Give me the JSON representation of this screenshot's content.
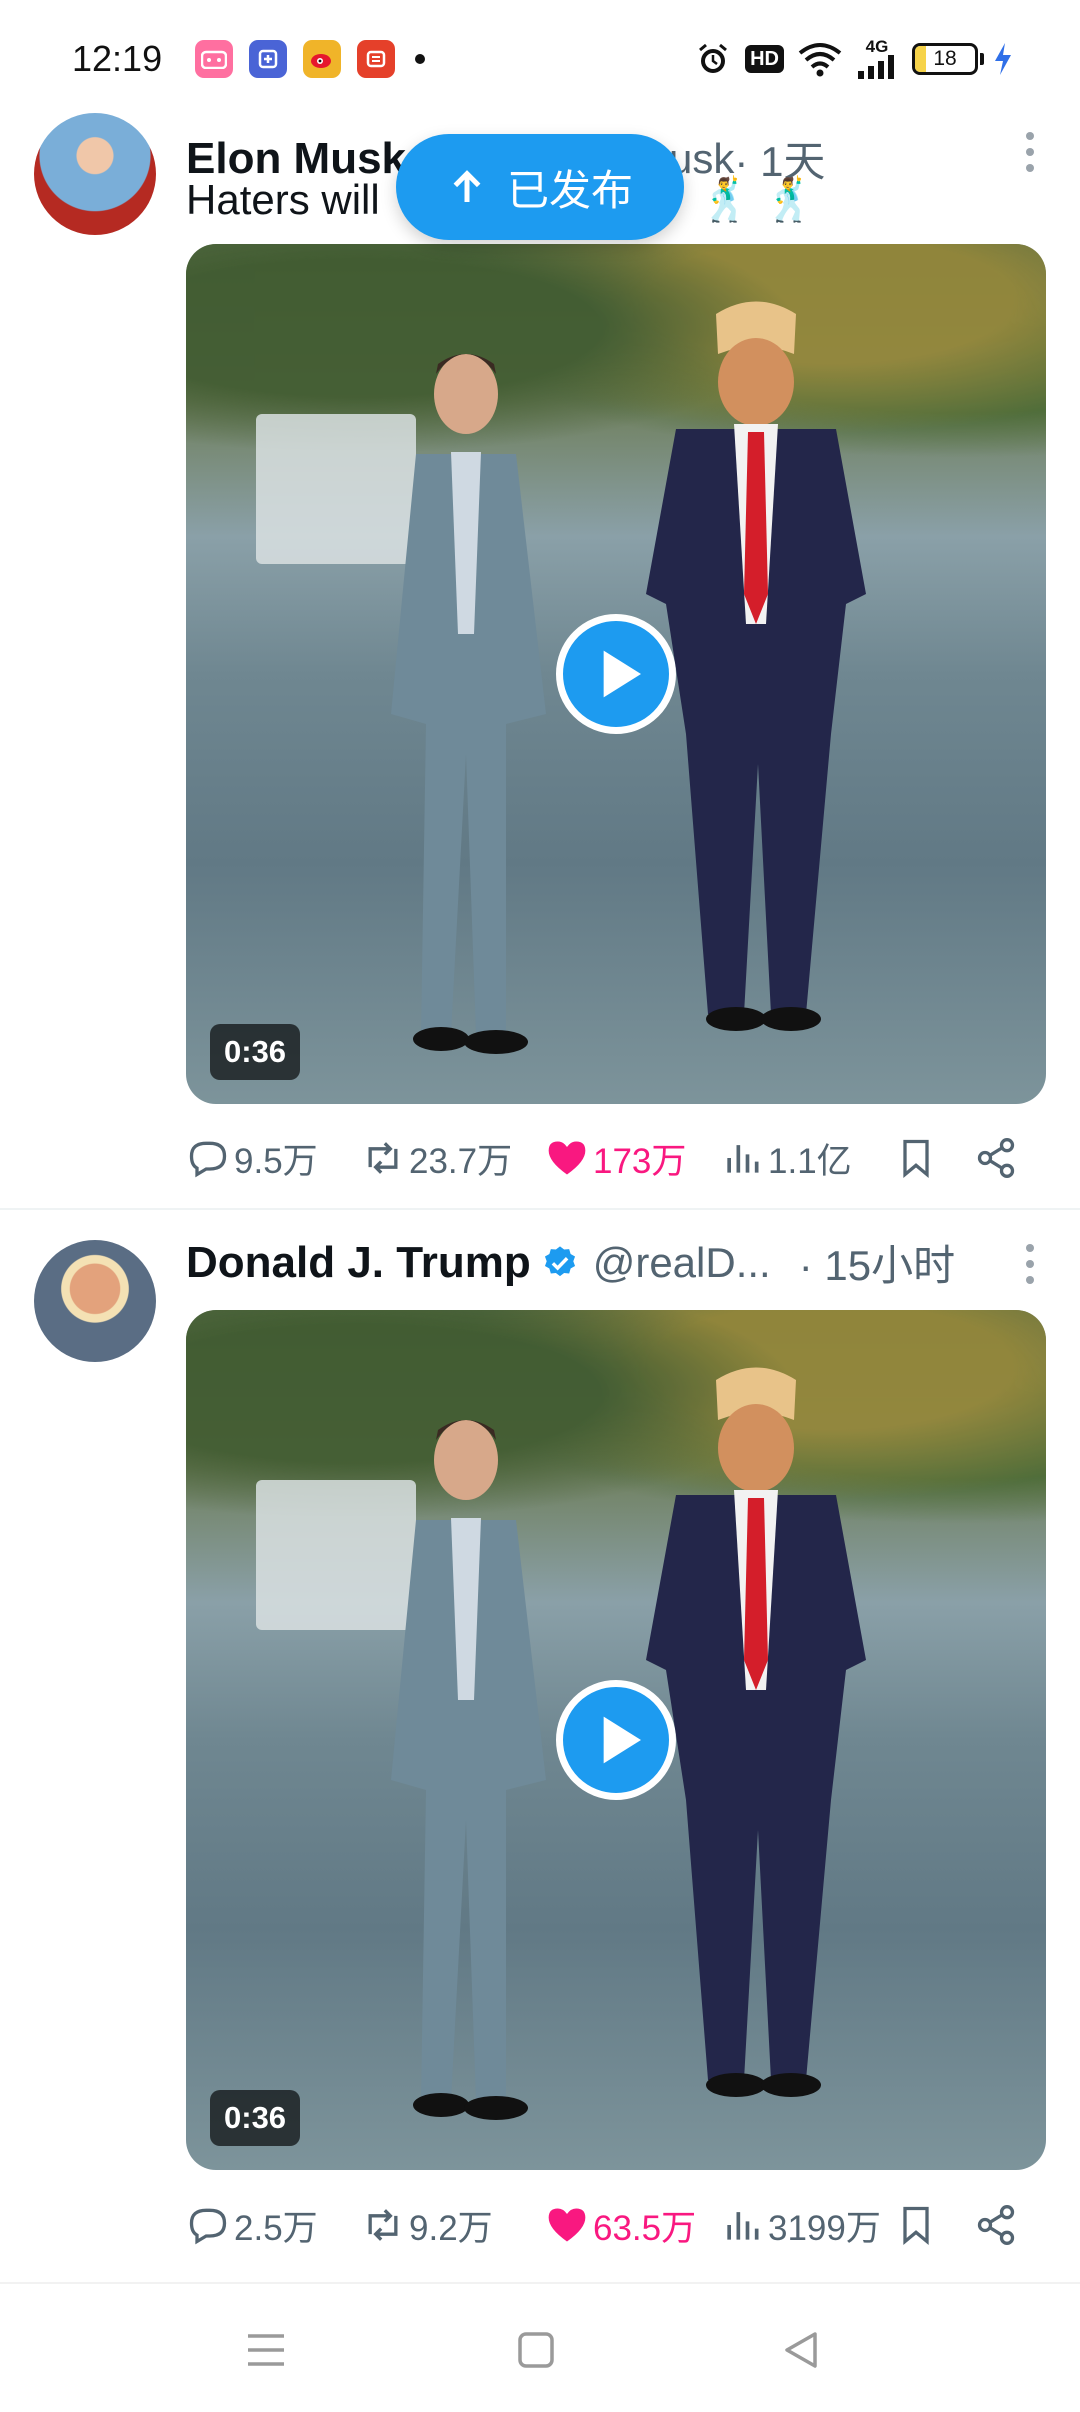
{
  "status_bar": {
    "time": "12:19",
    "network": "4G",
    "hd_label": "HD",
    "battery_level": "18",
    "battery_fraction": 0.18,
    "app_badges": [
      {
        "name": "bilibili-like-app-icon",
        "color": "#ff6fa0",
        "text": "bili"
      },
      {
        "name": "tieba-icon",
        "color": "#4a64d6",
        "text": "贴"
      },
      {
        "name": "weibo-icon",
        "color": "#f0b429",
        "text": "微"
      },
      {
        "name": "pinduoduo-icon",
        "color": "#e5402a",
        "text": "拼"
      }
    ]
  },
  "toast": {
    "text": "已发布"
  },
  "tweets": [
    {
      "display_name": "Elon Musk",
      "handle": "@elonmusk",
      "timestamp": "· 1天",
      "text": "Haters will",
      "text_emoji": "🕺 🕺",
      "video_duration": "0:36",
      "stats": {
        "replies": "9.5万",
        "retweets": "23.7万",
        "likes": "173万",
        "views": "1.1亿"
      }
    },
    {
      "display_name": "Donald J. Trump",
      "handle": "@realD...",
      "timestamp": "· 15小时",
      "video_duration": "0:36",
      "stats": {
        "replies": "2.5万",
        "retweets": "9.2万",
        "likes": "63.5万",
        "views": "3199万"
      }
    }
  ],
  "colors": {
    "accent": "#1d9bf0",
    "like": "#f91880",
    "muted": "#536471"
  }
}
